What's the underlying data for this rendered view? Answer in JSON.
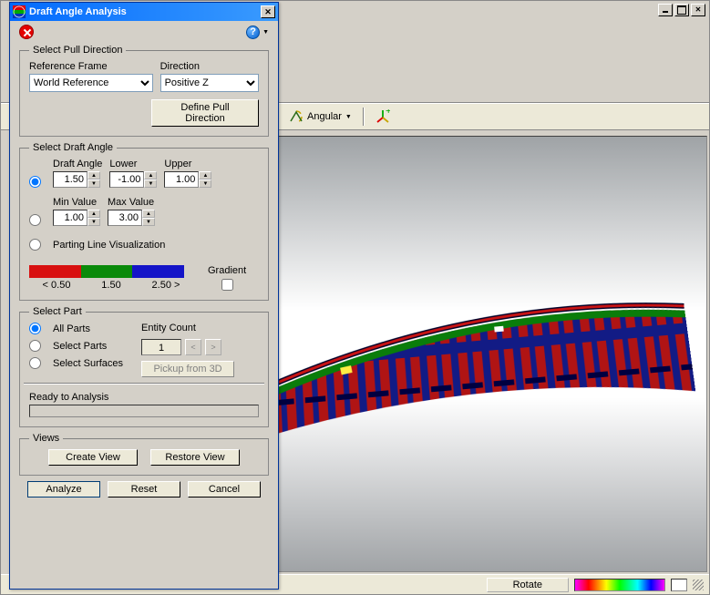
{
  "main_window": {
    "titlebar": {}
  },
  "toolbar": {
    "angular_label": "Angular"
  },
  "dialog": {
    "title": "Draft Angle Analysis",
    "help_label": "?",
    "pull_direction": {
      "legend": "Select Pull Direction",
      "ref_frame_label": "Reference Frame",
      "ref_frame_value": "World Reference",
      "direction_label": "Direction",
      "direction_value": "Positive Z",
      "define_button": "Define Pull Direction"
    },
    "draft_angle": {
      "legend": "Select Draft Angle",
      "draft_angle_label": "Draft Angle",
      "lower_label": "Lower",
      "upper_label": "Upper",
      "draft_angle_value": "1.50",
      "lower_value": "-1.00",
      "upper_value": "1.00",
      "min_label": "Min Value",
      "max_label": "Max Value",
      "min_value": "1.00",
      "max_value": "3.00",
      "parting_label": "Parting Line Visualization",
      "grad_low": "< 0.50",
      "grad_mid": "1.50",
      "grad_high": "2.50 >",
      "gradient_label": "Gradient",
      "colors": {
        "low": "#d81010",
        "mid": "#0a8a0a",
        "high": "#1414c8"
      }
    },
    "select_part": {
      "legend": "Select Part",
      "all_parts": "All Parts",
      "select_parts": "Select Parts",
      "select_surfaces": "Select Surfaces",
      "entity_count_label": "Entity Count",
      "entity_count_value": "1",
      "pickup_label": "Pickup from 3D",
      "status_label": "Ready to Analysis"
    },
    "views": {
      "legend": "Views",
      "create_view": "Create View",
      "restore_view": "Restore View"
    },
    "actions": {
      "analyze": "Analyze",
      "reset": "Reset",
      "cancel": "Cancel"
    }
  },
  "statusbar": {
    "rotate_label": "Rotate"
  }
}
